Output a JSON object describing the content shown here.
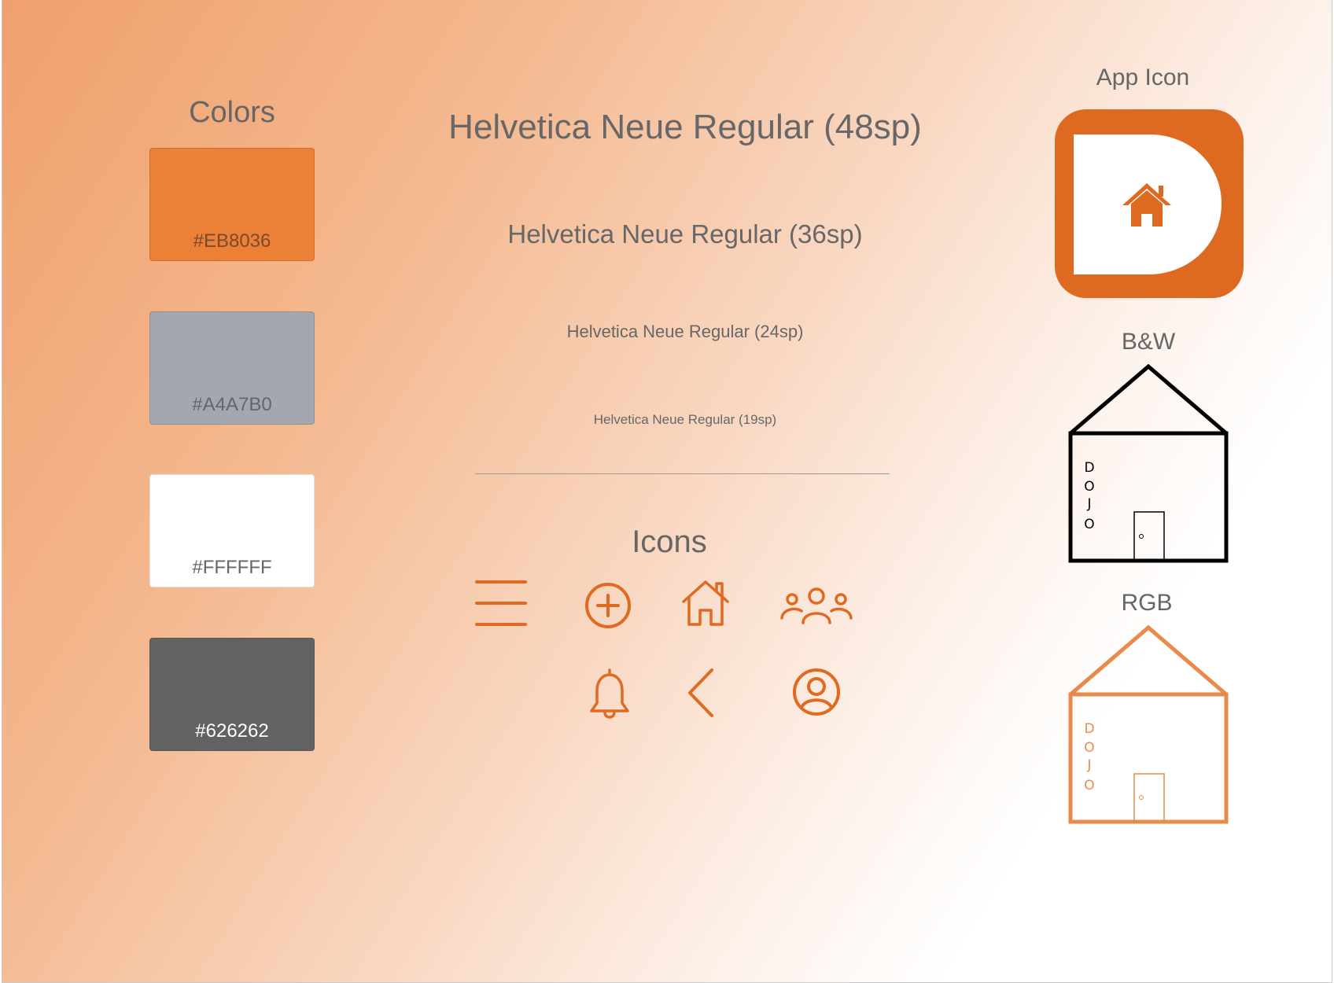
{
  "colors_section": {
    "title": "Colors",
    "swatches": [
      {
        "hex": "#EB8036",
        "label": "#EB8036",
        "text_color": "#7a4a2a"
      },
      {
        "hex": "#A4A7B0",
        "label": "#A4A7B0",
        "text_color": "#6a6a6a"
      },
      {
        "hex": "#FFFFFF",
        "label": "#FFFFFF",
        "text_color": "#6a6a6a"
      },
      {
        "hex": "#626262",
        "label": "#626262",
        "text_color": "#ffffff"
      }
    ]
  },
  "typography": {
    "samples": [
      {
        "label": "Helvetica Neue Regular (48sp)"
      },
      {
        "label": "Helvetica Neue Regular (36sp)"
      },
      {
        "label": "Helvetica Neue Regular (24sp)"
      },
      {
        "label": "Helvetica Neue Regular (19sp)"
      }
    ]
  },
  "icons_section": {
    "title": "Icons",
    "icons": [
      "menu-icon",
      "add-circle-icon",
      "home-icon",
      "group-icon",
      "bell-icon",
      "back-chevron-icon",
      "profile-icon"
    ],
    "icon_color": "#E06A22"
  },
  "logos": {
    "app_icon_title": "App Icon",
    "bw_title": "B&W",
    "rgb_title": "RGB",
    "dojo_letters": [
      "D",
      "O",
      "J",
      "O"
    ],
    "app_icon_color": "#DE6A22",
    "rgb_color": "#E98A4A"
  }
}
